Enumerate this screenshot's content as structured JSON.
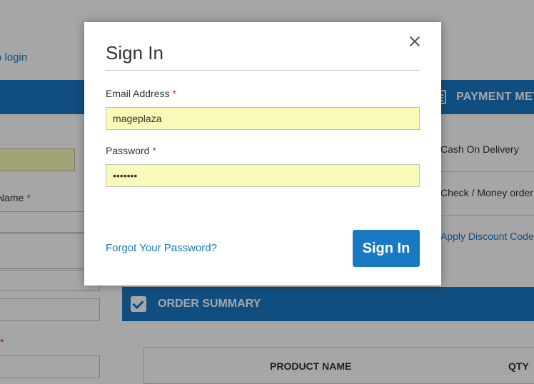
{
  "background": {
    "login_link": "o login",
    "name_label": "Name",
    "payment_header": "PAYMENT MET",
    "payment_options": [
      "Cash On Delivery",
      "Check / Money order"
    ],
    "discount_link": "Apply Discount Code",
    "order_summary": "ORDER SUMMARY",
    "table_headers": {
      "product_name": "PRODUCT NAME",
      "qty": "QTY"
    },
    "required_mark": "*"
  },
  "modal": {
    "title": "Sign In",
    "email_label": "Email Address",
    "email_value": "mageplaza",
    "password_label": "Password",
    "password_value": "•••••••",
    "required_mark": "*",
    "forgot_link": "Forgot Your Password?",
    "signin_button": "Sign In",
    "close_icon": "close-icon"
  },
  "colors": {
    "accent": "#1979c3",
    "autofill": "#fafab8",
    "required": "#e02b27"
  }
}
